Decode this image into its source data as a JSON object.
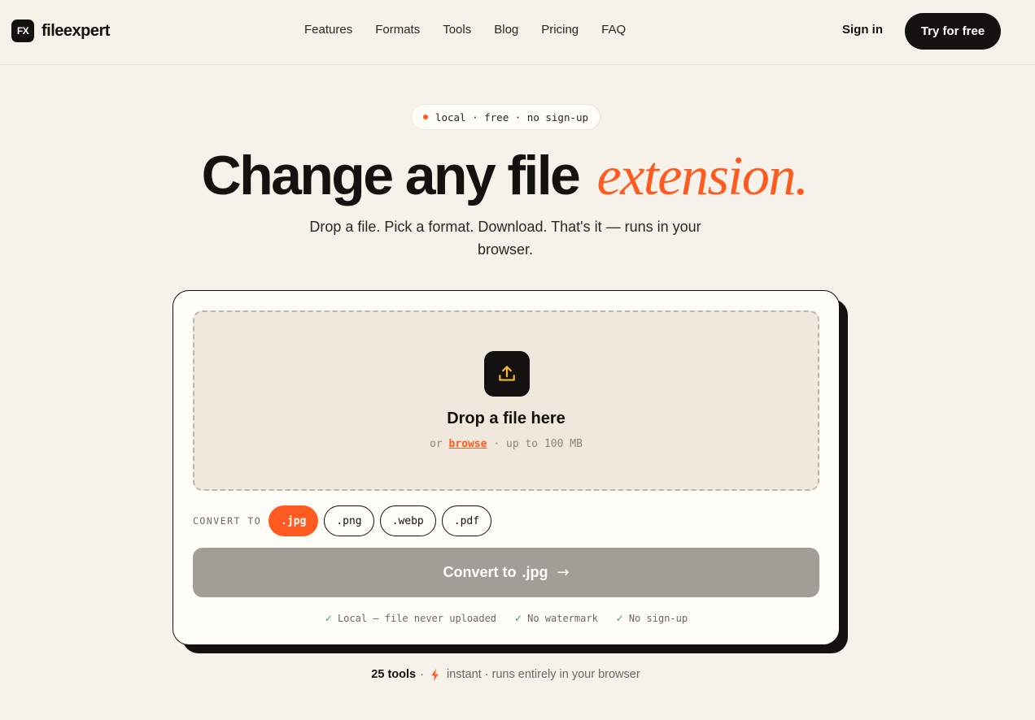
{
  "brand": {
    "logo_mark": "FX",
    "name": "fileexpert"
  },
  "nav": {
    "items": [
      "Features",
      "Formats",
      "Tools",
      "Blog",
      "Pricing",
      "FAQ"
    ]
  },
  "header": {
    "signin": "Sign in",
    "try": "Try for free"
  },
  "hero": {
    "pill": "local · free · no sign-up",
    "title_main": "Change any file",
    "title_accent": "extension.",
    "subtitle": "Drop a file. Pick a format. Download. That's it — runs in your browser."
  },
  "dropzone": {
    "icon": "upload-icon",
    "title": "Drop a file here",
    "or": "or",
    "browse": "browse",
    "limit": "· up to 100 MB"
  },
  "convert": {
    "label": "CONVERT TO",
    "formats": [
      ".jpg",
      ".png",
      ".webp",
      ".pdf"
    ],
    "selected": ".jpg",
    "button_prefix": "Convert to",
    "button_format": ".jpg",
    "button_arrow": "→"
  },
  "checks": [
    "Local — file never uploaded",
    "No watermark",
    "No sign-up"
  ],
  "footer": {
    "count": "25 tools",
    "sep": "·",
    "rest": "instant · runs entirely in your browser"
  },
  "colors": {
    "accent": "#ff5a1f",
    "ink": "#141210",
    "background": "#f6f2ea",
    "check": "#4f9c6b"
  }
}
